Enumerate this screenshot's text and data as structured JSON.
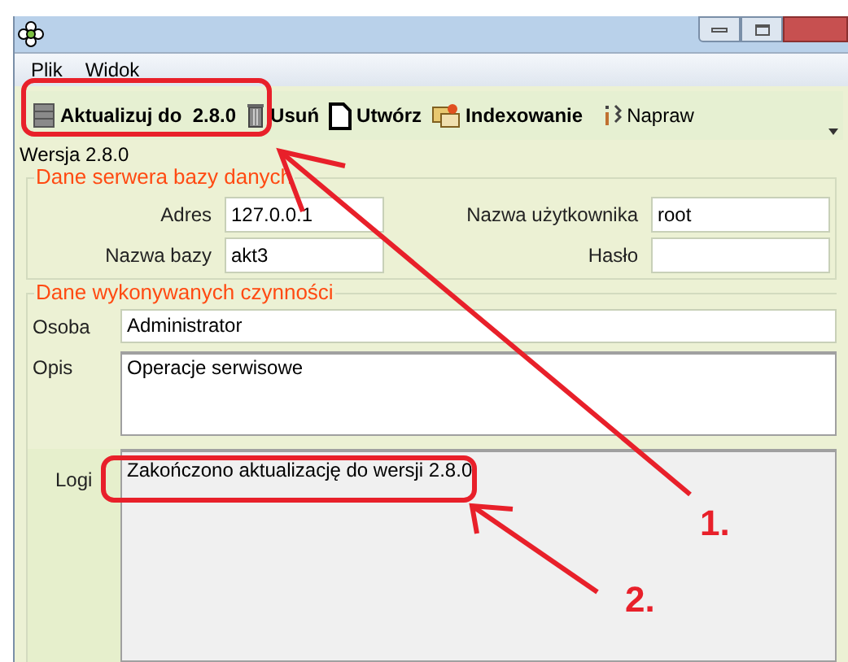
{
  "menu": [
    {
      "label": "Plik"
    },
    {
      "label": "Widok"
    }
  ],
  "toolbar": [
    {
      "label": "Aktualizuj do  2.8.0",
      "bold": true
    },
    {
      "label": "Usuń",
      "bold": true
    },
    {
      "label": "Utwórz",
      "bold": true
    },
    {
      "label": "Indexowanie",
      "bold": true
    },
    {
      "label": "Napraw",
      "bold": false
    }
  ],
  "version": "Wersja 2.8.0",
  "server_group": {
    "title": "Dane serwera bazy danych",
    "fields": [
      {
        "label": "Adres",
        "value": "127.0.0.1"
      },
      {
        "label": "Nazwa użytkownika",
        "value": "root"
      },
      {
        "label": "Nazwa bazy",
        "value": "akt3"
      },
      {
        "label": "Hasło"
      }
    ]
  },
  "activity_group": {
    "title": "Dane wykonywanych czynności",
    "person": {
      "label": "Osoba",
      "value": "Administrator"
    },
    "description": {
      "label": "Opis",
      "value": "Operacje serwisowe"
    },
    "logs": {
      "label": "Logi",
      "value": "Zakończono aktualizację do wersji 2.8.0"
    }
  },
  "annotations": [
    {
      "label": "1."
    },
    {
      "label": "2."
    }
  ]
}
